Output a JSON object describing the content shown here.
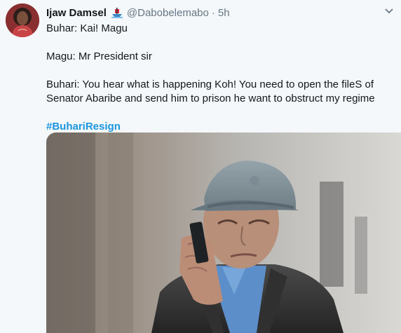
{
  "tweet": {
    "author_name": "Ijaw Damsel",
    "handle": "@Dabobelemabo",
    "separator": "·",
    "timestamp": "5h",
    "lines": [
      "Buhar: Kai! Magu",
      "",
      "Magu: Mr President sir",
      "",
      "Buhari: You hear what is happening Koh! You need to open the fileS of",
      "Senator Abaribe and send him to prison he want to obstruct my regime",
      ""
    ],
    "hashtag": "#BuhariResign",
    "icons": {
      "avatar": "profile-photo",
      "badge": "boat-emoji-icon",
      "menu": "chevron-down-icon"
    },
    "colors": {
      "link": "#1b95e0",
      "muted": "#657786",
      "text": "#14171a"
    }
  }
}
